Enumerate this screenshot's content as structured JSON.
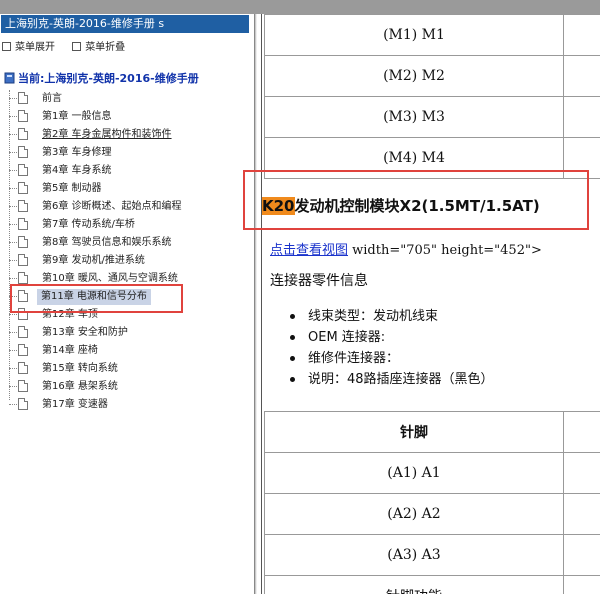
{
  "left_pane": {
    "title": "上海别克-英朗-2016-维修手册 s",
    "menu_expand": "菜单展开",
    "menu_collapse": "菜单折叠",
    "current_book": "当前:上海别克-英朗-2016-维修手册",
    "items": [
      {
        "label": "前言"
      },
      {
        "label": "第1章 一般信息"
      },
      {
        "label": "第2章 车身金属构件和装饰件"
      },
      {
        "label": "第3章 车身修理"
      },
      {
        "label": "第4章 车身系统"
      },
      {
        "label": "第5章 制动器"
      },
      {
        "label": "第6章 诊断概述、起始点和编程"
      },
      {
        "label": "第7章 传动系统/车桥"
      },
      {
        "label": "第8章 驾驶员信息和娱乐系统"
      },
      {
        "label": "第9章 发动机/推进系统"
      },
      {
        "label": "第10章 暖风、通风与空调系统"
      },
      {
        "label": "第11章 电源和信号分布"
      },
      {
        "label": "第12章 车顶"
      },
      {
        "label": "第13章 安全和防护"
      },
      {
        "label": "第14章 座椅"
      },
      {
        "label": "第15章 转向系统"
      },
      {
        "label": "第16章 悬架系统"
      },
      {
        "label": "第17章 变速器"
      }
    ]
  },
  "right_pane": {
    "top_table_rows": [
      "(M1) M1",
      "(M2) M2",
      "(M3) M3",
      "(M4) M4"
    ],
    "heading_code": "K20",
    "heading_rest": "发动机控制模块X2(1.5MT/1.5AT)",
    "link_text": "点击查看视图",
    "link_suffix": " width=\"705\" height=\"452\">",
    "connector_info_title": "连接器零件信息",
    "bullets": [
      "线束类型：发动机线束",
      "OEM 连接器:",
      "维修件连接器：",
      "说明：48路插座连接器（黑色）"
    ],
    "pin_table_header": "针脚",
    "pin_rows": [
      "(A1) A1",
      "(A2) A2",
      "(A3) A3",
      "针脚功能"
    ]
  }
}
